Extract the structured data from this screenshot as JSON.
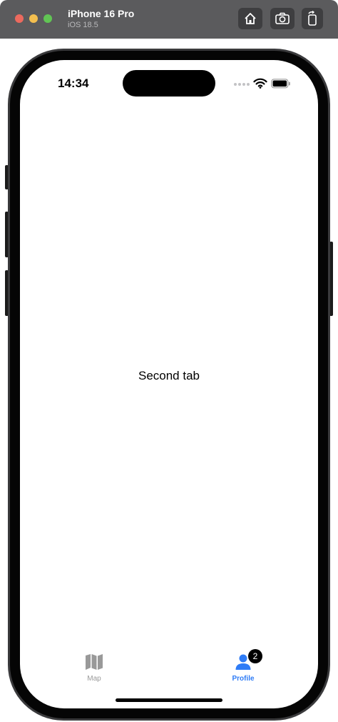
{
  "window": {
    "device_name": "iPhone 16 Pro",
    "os_version": "iOS 18.5",
    "toolbar": [
      {
        "icon": "home-icon"
      },
      {
        "icon": "camera-icon"
      },
      {
        "icon": "rotate-icon"
      }
    ]
  },
  "status_bar": {
    "time": "14:34",
    "icons": [
      "signal-dots-icon",
      "wifi-icon",
      "battery-icon"
    ]
  },
  "main": {
    "label": "Second tab"
  },
  "tab_bar": {
    "tabs": [
      {
        "label": "Map",
        "icon": "map-icon",
        "selected": false
      },
      {
        "label": "Profile",
        "icon": "person-icon",
        "selected": true,
        "badge": "2"
      }
    ],
    "colors": {
      "selected": "#2f7cf6",
      "unselected": "#999999"
    }
  }
}
